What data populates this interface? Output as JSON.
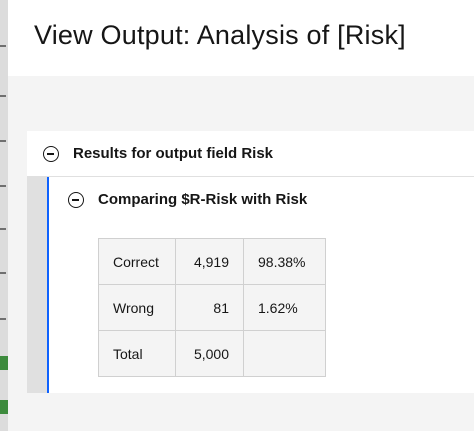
{
  "modal": {
    "title": "View Output: Analysis of [Risk]"
  },
  "panel": {
    "title": "Results for output field Risk",
    "section": {
      "title": "Comparing $R-Risk with Risk",
      "rows": [
        {
          "label": "Correct",
          "count": "4,919",
          "percent": "98.38%"
        },
        {
          "label": "Wrong",
          "count": "81",
          "percent": "1.62%"
        },
        {
          "label": "Total",
          "count": "5,000",
          "percent": ""
        }
      ]
    }
  }
}
